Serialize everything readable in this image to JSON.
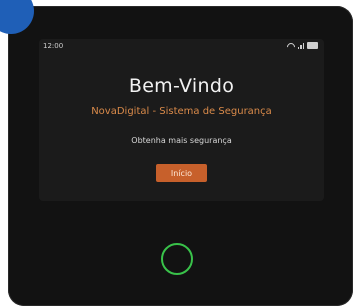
{
  "status_bar": {
    "time": "12:00",
    "icons": [
      "wifi-icon",
      "signal-icon",
      "battery-icon"
    ]
  },
  "welcome": {
    "title": "Bem-Vindo",
    "subtitle": "NovaDigital - Sistema de Segurança",
    "tagline": "Obtenha mais segurança",
    "start_button_label": "Início"
  },
  "colors": {
    "accent": "#c7602b",
    "subtitle": "#d98a4a",
    "home_ring": "#39c24a",
    "badge": "#1f5fb7"
  }
}
